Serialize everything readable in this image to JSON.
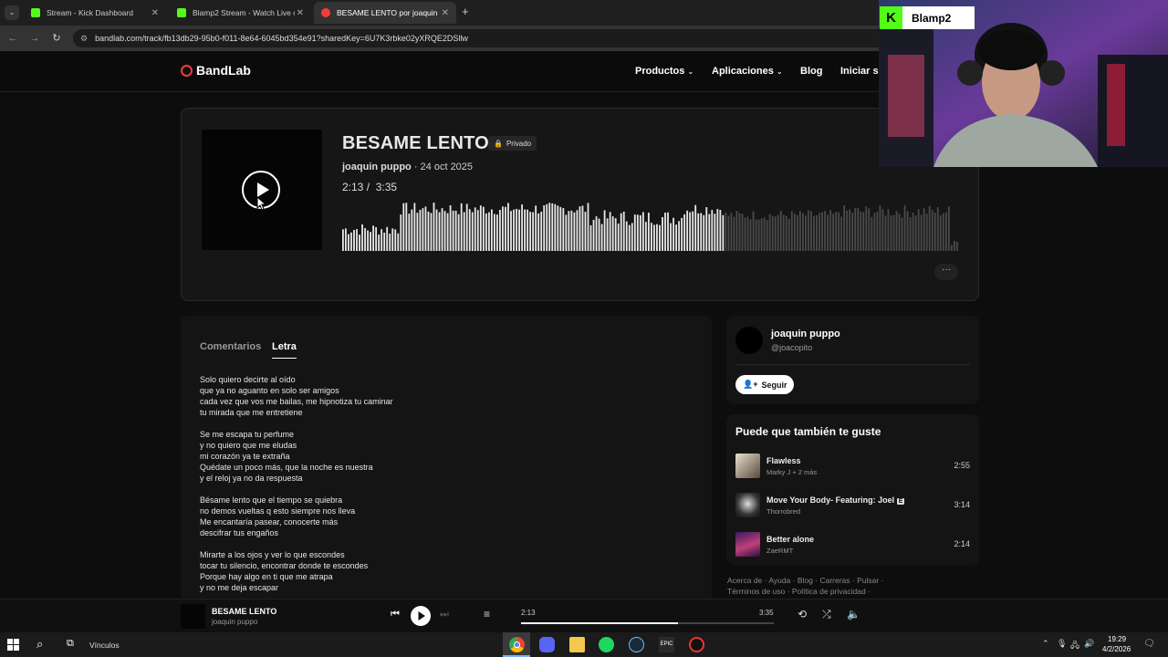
{
  "browser": {
    "tabs": [
      {
        "title": "Stream - Kick Dashboard",
        "color": "#53fc18"
      },
      {
        "title": "Blamp2 Stream - Watch Live on",
        "color": "#53fc18"
      },
      {
        "title": "BESAME LENTO por joaquin pu",
        "color": "#f23c3c"
      }
    ],
    "url": "bandlab.com/track/fb13db29-95b0-f011-8e64-6045bd354e91?sharedKey=6U7K3rbke02yXRQE2DSllw"
  },
  "site": {
    "brand": "BandLab",
    "nav": [
      "Productos",
      "Aplicaciones",
      "Blog",
      "Iniciar se"
    ]
  },
  "track": {
    "title": "BESAME LENTO",
    "privacy": "Privado",
    "artist": "joaquin puppo",
    "date": "24 oct 2025",
    "current_time": "2:13",
    "duration": "3:35",
    "progress": 0.62
  },
  "panel": {
    "tabs": [
      "Comentarios",
      "Letra"
    ],
    "active_tab": "Letra",
    "lyrics": [
      [
        "Solo quiero decirte al oído",
        "que ya no aguanto en solo ser amigos",
        "cada vez que vos me bailas, me hipnotiza tu caminar",
        "tu mirada que me entretiene"
      ],
      [
        "Se me escapa tu perfume",
        "y no quiero que me eludas",
        "mi corazón ya te extraña",
        "Quédate un poco más, que la noche es nuestra",
        "y el reloj ya no da respuesta"
      ],
      [
        "Bésame lento que el tiempo se quiebra",
        "no demos vueltas q esto siempre nos lleva",
        "Me encantaría pasear, conocerte más",
        "descifrar tus engaños"
      ],
      [
        "Mirarte a los ojos y ver lo que escondes",
        "tocar tu silencio, encontrar donde te escondes",
        "Porque hay algo en ti que me atrapa",
        "y no me deja escapar"
      ]
    ]
  },
  "artist_card": {
    "name": "joaquin puppo",
    "handle": "@joacopito",
    "follow_label": "Seguir"
  },
  "recommendations": {
    "heading": "Puede que también te guste",
    "items": [
      {
        "title": "Flawless",
        "artist": "Marky J + 2 más",
        "duration": "2:55"
      },
      {
        "title": "Move Your Body- Featuring: Joel",
        "badge": "E",
        "artist": "Thorrobred",
        "duration": "3:14"
      },
      {
        "title": "Better alone",
        "artist": "ZaeRMT",
        "duration": "2:14"
      }
    ]
  },
  "footer": {
    "links": [
      "Acerca de",
      "Ayuda",
      "Blog",
      "Carreras",
      "Pulsar",
      "Términos de uso",
      "Política de privacidad"
    ]
  },
  "player": {
    "title": "BESAME LENTO",
    "artist": "joaquin puppo",
    "current_time": "2:13",
    "duration": "3:35",
    "progress": 0.62
  },
  "overlay": {
    "channel": "Blamp2"
  },
  "taskbar": {
    "links_label": "Vínculos",
    "time": "19:29",
    "date": "4/2/2026"
  }
}
